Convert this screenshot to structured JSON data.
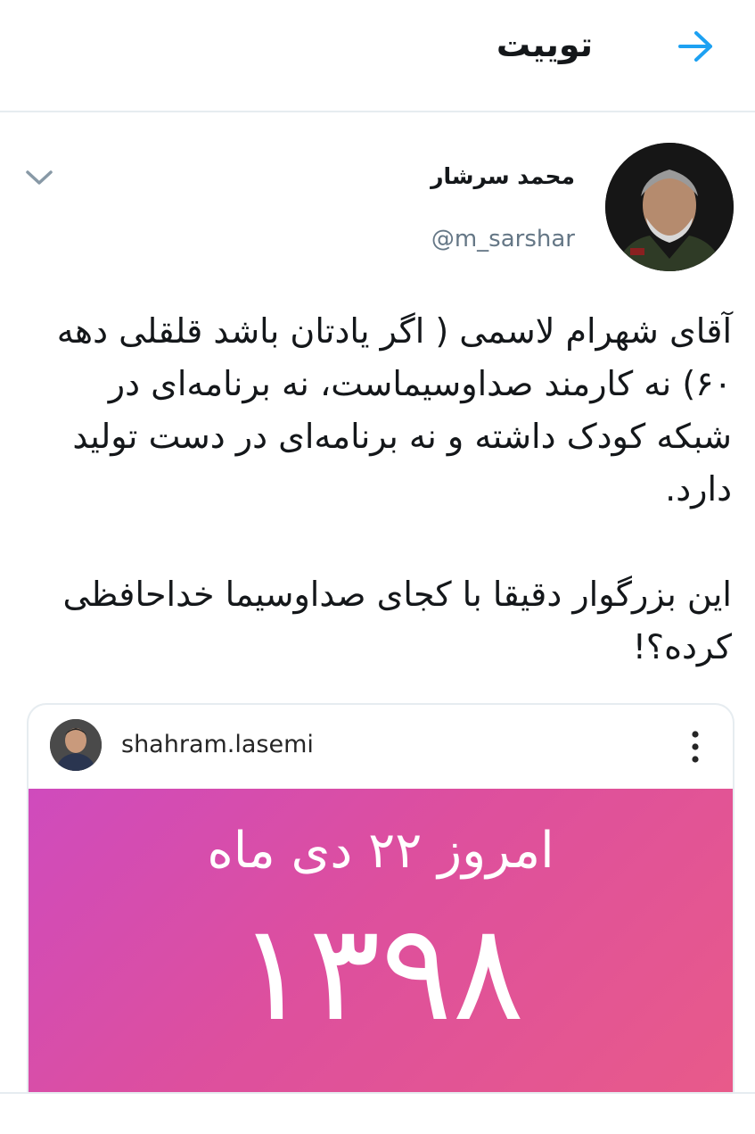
{
  "header": {
    "title": "توییت",
    "back_icon": "arrow-right-icon",
    "accent": "#1da1f2"
  },
  "tweet": {
    "author_name": "محمد سرشار",
    "author_handle": "@m_sarshar",
    "menu_icon": "chevron-down-icon",
    "paragraphs": [
      "آقای شهرام لاسمی ( اگر یادتان باشد قلقلی دهه ۶۰) نه کارمند صداوسیماست، نه برنامه‌ای در شبکه کودک داشته و نه برنامه‌ای در دست تولید دارد.",
      "این بزرگوار دقیقا با کجای صداوسیما خداحافظی کرده؟!"
    ]
  },
  "embedded_post": {
    "username": "shahram.lasemi",
    "more_icon": "more-vertical-icon",
    "image_text": {
      "line1": "امروز ۲۲ دی ماه",
      "line2": "۱۳۹۸"
    }
  }
}
